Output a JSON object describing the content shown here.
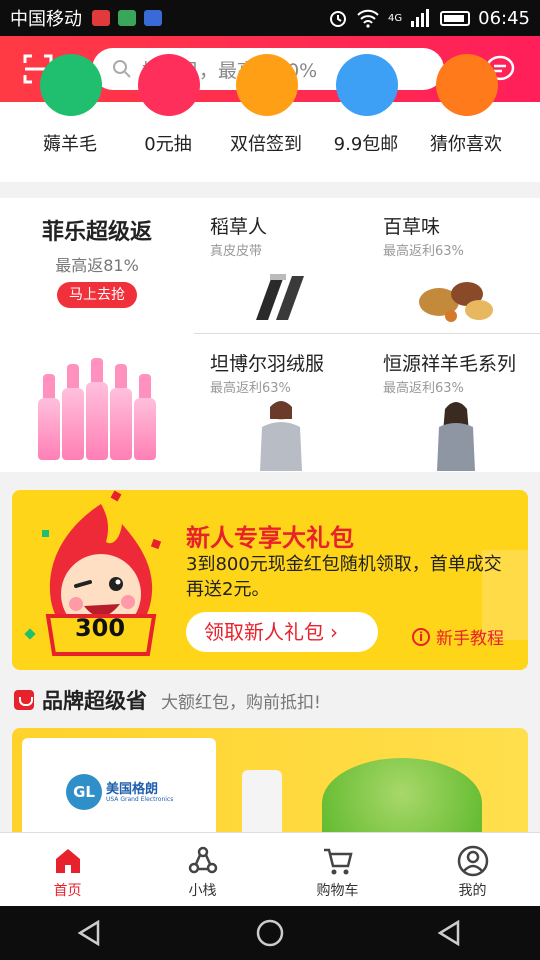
{
  "status_bar": {
    "carrier": "中国移动",
    "network": "4G",
    "time": "06:45"
  },
  "header": {
    "search_placeholder": "搜宝贝，最高返80%"
  },
  "quick_row": [
    {
      "label": "薅羊毛",
      "color": "#1fbf6f"
    },
    {
      "label": "0元抽",
      "color": "#ff2f5c"
    },
    {
      "label": "双倍签到",
      "color": "#ff9f16"
    },
    {
      "label": "9.9包邮",
      "color": "#3ea0f5"
    },
    {
      "label": "猜你喜欢",
      "color": "#ff7a1a"
    }
  ],
  "brand_grid": {
    "feature": {
      "title": "菲乐超级返",
      "subtitle": "最高返81%",
      "button": "马上去抢"
    },
    "cells": [
      {
        "title": "稻草人",
        "subtitle": "真皮皮带"
      },
      {
        "title": "百草味",
        "subtitle": "最高返利63%"
      },
      {
        "title": "坦博尔羽绒服",
        "subtitle": "最高返利63%"
      },
      {
        "title": "恒源祥羊毛系列",
        "subtitle": "最高返利63%"
      }
    ]
  },
  "banner": {
    "badge_number": "300",
    "title": "新人专享大礼包",
    "description": "3到800元现金红包随机领取，首单成交再送2元。",
    "button": "领取新人礼包",
    "tutorial": "新手教程"
  },
  "section": {
    "title": "品牌超级省",
    "subtitle": "大额红包，购前抵扣!"
  },
  "promo": {
    "brand_cn": "美国格朗",
    "brand_en": "USA Grand Electronics",
    "logo_text": "GL"
  },
  "tabs": [
    {
      "label": "首页",
      "active": true
    },
    {
      "label": "小栈",
      "active": false
    },
    {
      "label": "购物车",
      "active": false
    },
    {
      "label": "我的",
      "active": false
    }
  ],
  "colors": {
    "accent": "#e8222c",
    "header_start": "#ff3a45",
    "header_end": "#ff1f5a",
    "banner": "#ffd51a"
  }
}
